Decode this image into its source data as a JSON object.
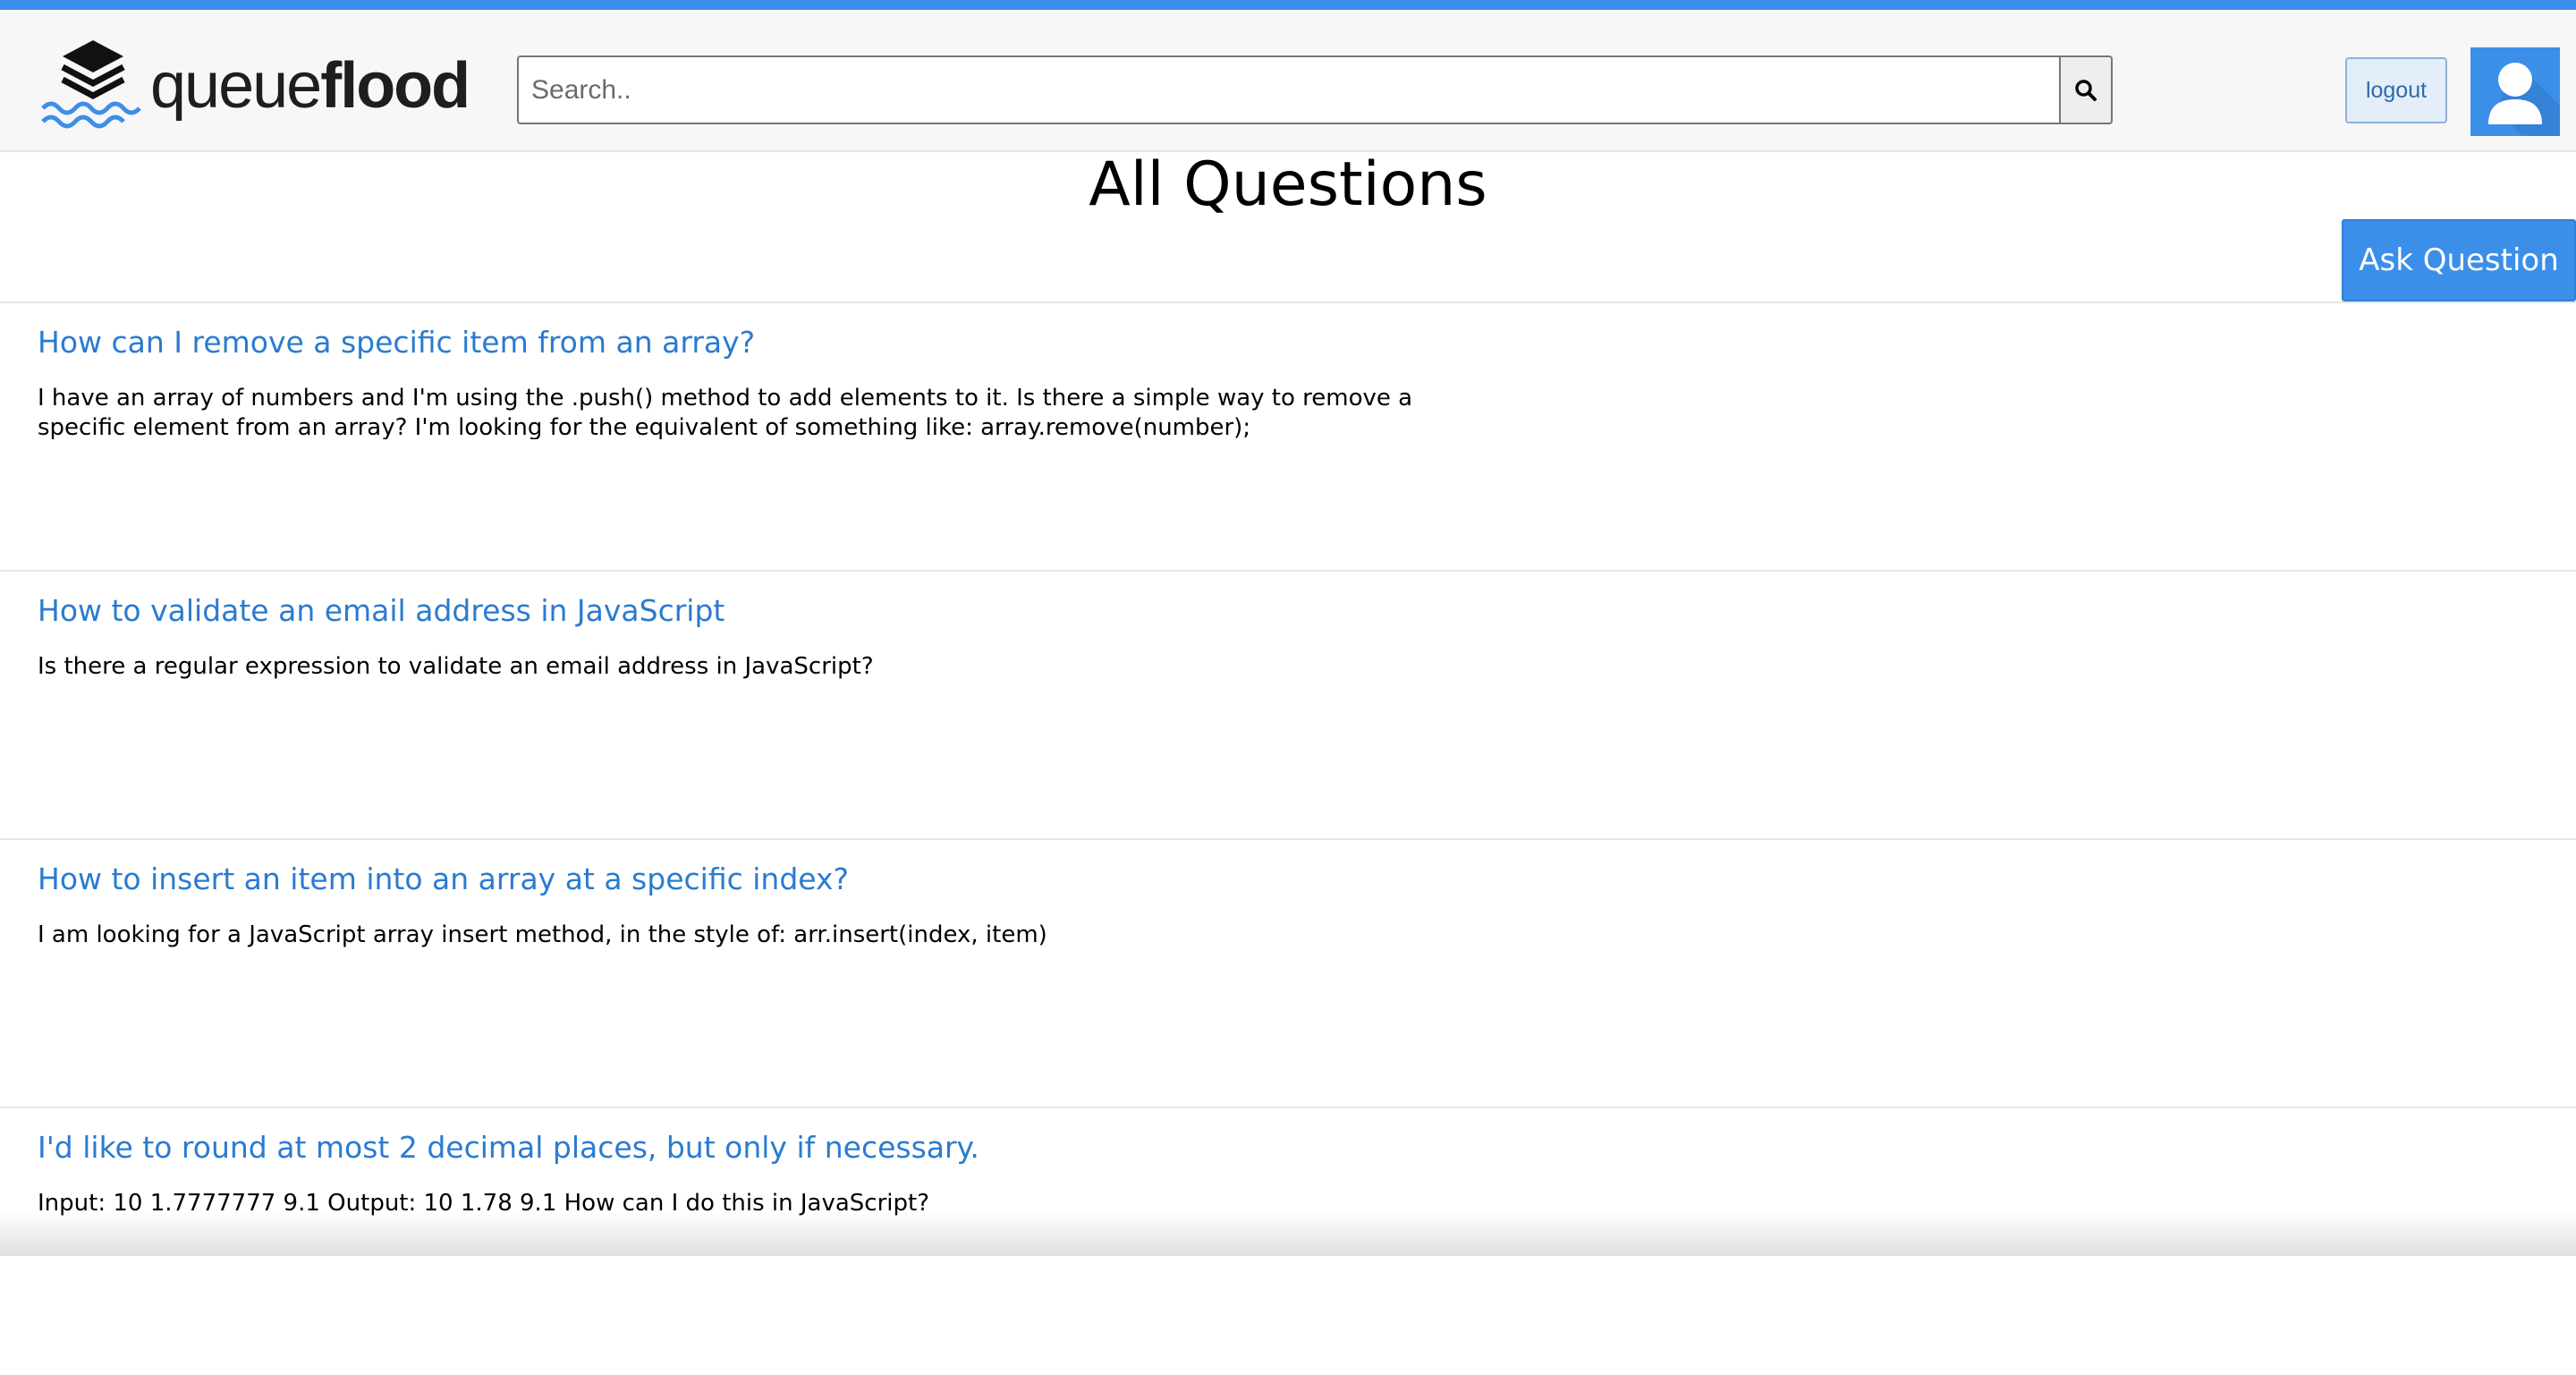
{
  "brand": {
    "name_light": "queue",
    "name_bold": "flood",
    "accent_color": "#3c8fe8",
    "logo_icon": "stacked-layers-waves-icon"
  },
  "header": {
    "search": {
      "placeholder": "Search..",
      "value": "",
      "button_icon": "search-icon"
    },
    "logout_label": "logout",
    "avatar_icon": "user-avatar-icon"
  },
  "page": {
    "title": "All Questions",
    "ask_button_label": "Ask Question"
  },
  "questions": [
    {
      "title": "How can I remove a specific item from an array?",
      "body": "I have an array of numbers and I'm using the .push() method to add elements to it. Is there a simple way to remove a specific element from an array? I'm looking for the equivalent of something like: array.remove(number);"
    },
    {
      "title": "How to validate an email address in JavaScript",
      "body": "Is there a regular expression to validate an email address in JavaScript?"
    },
    {
      "title": "How to insert an item into an array at a specific index?",
      "body": "I am looking for a JavaScript array insert method, in the style of: arr.insert(index, item)"
    },
    {
      "title": "I'd like to round at most 2 decimal places, but only if necessary.",
      "body": "Input: 10 1.7777777 9.1 Output: 10 1.78 9.1 How can I do this in JavaScript?"
    }
  ]
}
